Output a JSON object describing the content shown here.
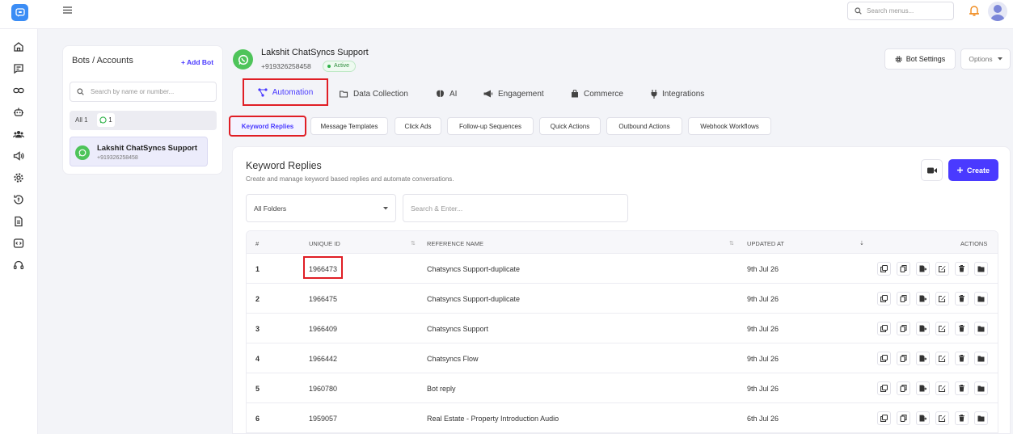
{
  "topbar": {
    "search_placeholder": "Search menus...",
    "accent": "#4a3aff",
    "highlight": "#e01e25"
  },
  "sidebar": {
    "items": [
      "home-icon",
      "chat-icon",
      "link-icon",
      "bot-icon",
      "users-icon",
      "megaphone-icon",
      "settings-icon",
      "billing-icon",
      "document-icon",
      "code-icon",
      "headset-icon"
    ]
  },
  "bots_panel": {
    "title": "Bots / Accounts",
    "add_label": "+ Add Bot",
    "search_placeholder": "Search by name or number...",
    "filter_all": "All 1",
    "filter_wa_count": "1",
    "bot": {
      "name": "Lakshit ChatSyncs Support",
      "phone": "+919326258458"
    }
  },
  "header": {
    "name": "Lakshit ChatSyncs Support",
    "phone": "+919326258458",
    "status": "Active",
    "bot_settings": "Bot Settings",
    "options": "Options"
  },
  "main_tabs": [
    "Automation",
    "Data Collection",
    "AI",
    "Engagement",
    "Commerce",
    "Integrations"
  ],
  "sub_tabs": [
    "Keyword Replies",
    "Message Templates",
    "Click Ads",
    "Follow-up Sequences",
    "Quick Actions",
    "Outbound Actions",
    "Webhook Workflows"
  ],
  "content": {
    "title": "Keyword Replies",
    "subtitle": "Create and manage keyword based replies and automate conversations.",
    "create_label": "Create",
    "folder_select": "All Folders",
    "search_placeholder": "Search & Enter..."
  },
  "table": {
    "headers": {
      "num": "#",
      "uid": "UNIQUE ID",
      "ref": "REFERENCE NAME",
      "updated": "UPDATED AT",
      "actions": "ACTIONS"
    },
    "rows": [
      {
        "num": "1",
        "uid": "1966473",
        "ref": "Chatsyncs Support-duplicate",
        "updated": "9th Jul 26"
      },
      {
        "num": "2",
        "uid": "1966475",
        "ref": "Chatsyncs Support-duplicate",
        "updated": "9th Jul 26"
      },
      {
        "num": "3",
        "uid": "1966409",
        "ref": "Chatsyncs Support",
        "updated": "9th Jul 26"
      },
      {
        "num": "4",
        "uid": "1966442",
        "ref": "Chatsyncs Flow",
        "updated": "9th Jul 26"
      },
      {
        "num": "5",
        "uid": "1960780",
        "ref": "Bot reply",
        "updated": "9th Jul 26"
      },
      {
        "num": "6",
        "uid": "1959057",
        "ref": "Real Estate - Property Introduction Audio",
        "updated": "6th Jul 26"
      }
    ]
  }
}
